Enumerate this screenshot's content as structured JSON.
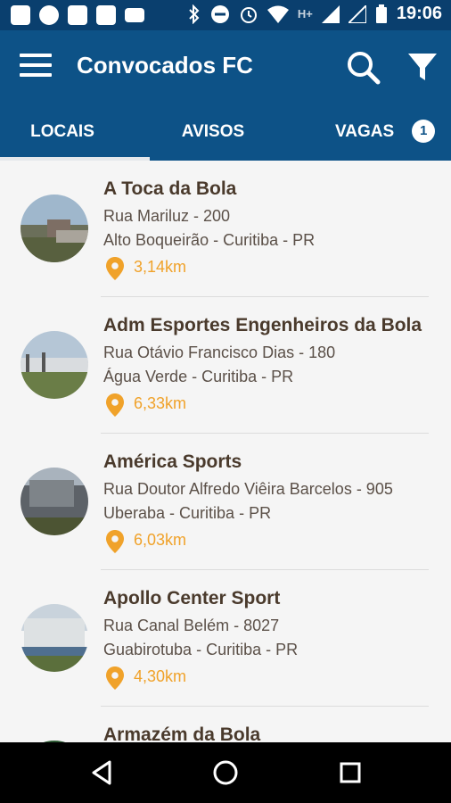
{
  "status_bar": {
    "time": "19:06",
    "network": "H+"
  },
  "app_bar": {
    "title": "Convocados FC"
  },
  "tabs": [
    {
      "label": "LOCAIS",
      "selected": true
    },
    {
      "label": "AVISOS",
      "selected": false
    },
    {
      "label": "VAGAS",
      "badge": "1",
      "selected": false
    }
  ],
  "locations": [
    {
      "name": "A Toca da Bola",
      "street": "Rua Mariluz - 200",
      "area": "Alto Boqueirão - Curitiba - PR",
      "distance": "3,14km"
    },
    {
      "name": "Adm Esportes Engenheiros da Bola",
      "street": "Rua Otávio Francisco Dias - 180",
      "area": "Água Verde - Curitiba - PR",
      "distance": "6,33km"
    },
    {
      "name": "América Sports",
      "street": "Rua Doutor Alfredo Viêira Barcelos - 905",
      "area": "Uberaba - Curitiba - PR",
      "distance": "6,03km"
    },
    {
      "name": "Apollo Center Sport",
      "street": "Rua Canal Belém - 8027",
      "area": "Guabirotuba - Curitiba - PR",
      "distance": "4,30km"
    },
    {
      "name": "Armazém da Bola",
      "street": "",
      "area": "",
      "distance": ""
    }
  ],
  "colors": {
    "primary": "#0d5287",
    "status_bar": "#0a3f6e",
    "accent_orange": "#f0a22a"
  }
}
